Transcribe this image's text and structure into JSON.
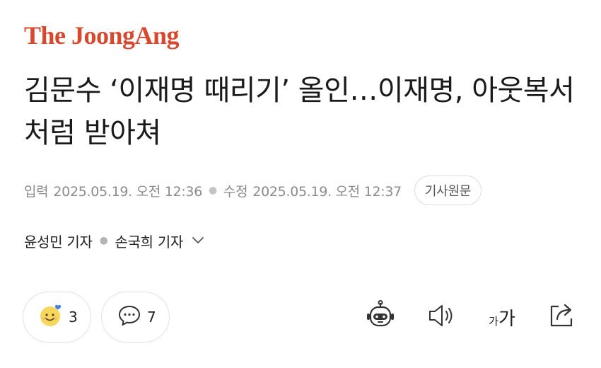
{
  "brand": {
    "logo_text": "The JoongAng",
    "logo_color": "#d6492e"
  },
  "article": {
    "headline": "김문수 ‘이재명 때리기’ 올인…이재명, 아웃복서처럼 받아쳐",
    "published_label": "입력",
    "published": "2025.05.19. 오전 12:36",
    "modified_label": "수정",
    "modified": "2025.05.19. 오전 12:37",
    "original_button": "기사원문",
    "reporters": [
      "윤성민 기자",
      "손국희 기자"
    ]
  },
  "actions": {
    "reaction_count": "3",
    "comment_count": "7",
    "font_small": "가",
    "font_big": "가"
  },
  "icons": {
    "reaction": "smile-face-heart-icon",
    "comment": "speech-bubble-icon",
    "ai": "robot-icon",
    "listen": "speaker-icon",
    "font": "font-size-icon",
    "share": "share-icon",
    "byline_more": "chevron-down-icon"
  },
  "colors": {
    "text_primary": "#1a1a1a",
    "text_meta": "#8b8b8b",
    "border": "#e2e2e2",
    "emoji_yellow": "#f7d65c",
    "emoji_heart": "#3f7de8"
  }
}
